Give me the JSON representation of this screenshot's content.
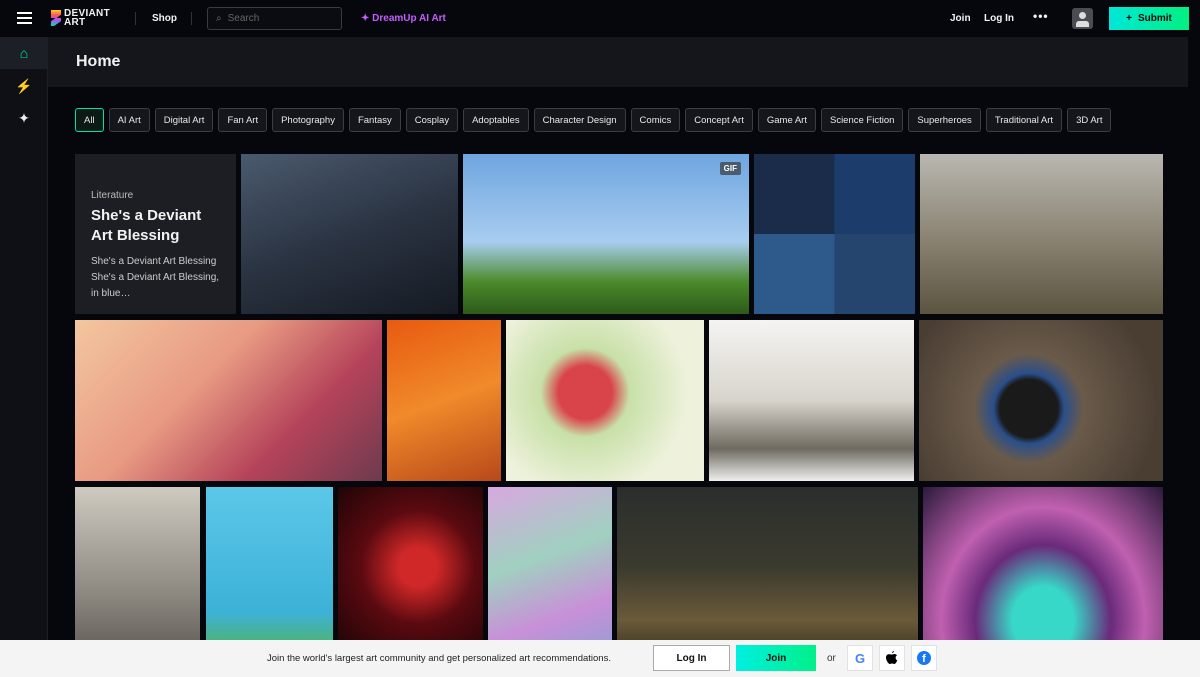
{
  "topbar": {
    "logo": "DEVIANT ART",
    "shop": "Shop",
    "search_placeholder": "Search",
    "dreamup": "DreamUp AI Art",
    "join": "Join",
    "login": "Log In",
    "more": "•••",
    "submit": "Submit"
  },
  "sidebar": {
    "items": [
      {
        "name": "home",
        "icon": "⌂"
      },
      {
        "name": "watch",
        "icon": "⚡"
      },
      {
        "name": "dreamup",
        "icon": "✦"
      }
    ]
  },
  "page": {
    "title": "Home"
  },
  "chips": [
    "All",
    "AI Art",
    "Digital Art",
    "Fan Art",
    "Photography",
    "Fantasy",
    "Cosplay",
    "Adoptables",
    "Character Design",
    "Comics",
    "Concept Art",
    "Game Art",
    "Science Fiction",
    "Superheroes",
    "Traditional Art",
    "3D Art"
  ],
  "literature": {
    "category": "Literature",
    "title": "She's a Deviant Art Blessing",
    "excerpt": "She's a Deviant Art Blessing She's a Deviant Art Blessing, in blue…"
  },
  "gif_badge": "GIF",
  "banner": {
    "message": "Join the world's largest art community and get personalized art recommendations.",
    "login": "Log In",
    "join": "Join",
    "or": "or"
  },
  "colors": {
    "accent": "#00e59b",
    "dreamup": "#c65cff"
  }
}
